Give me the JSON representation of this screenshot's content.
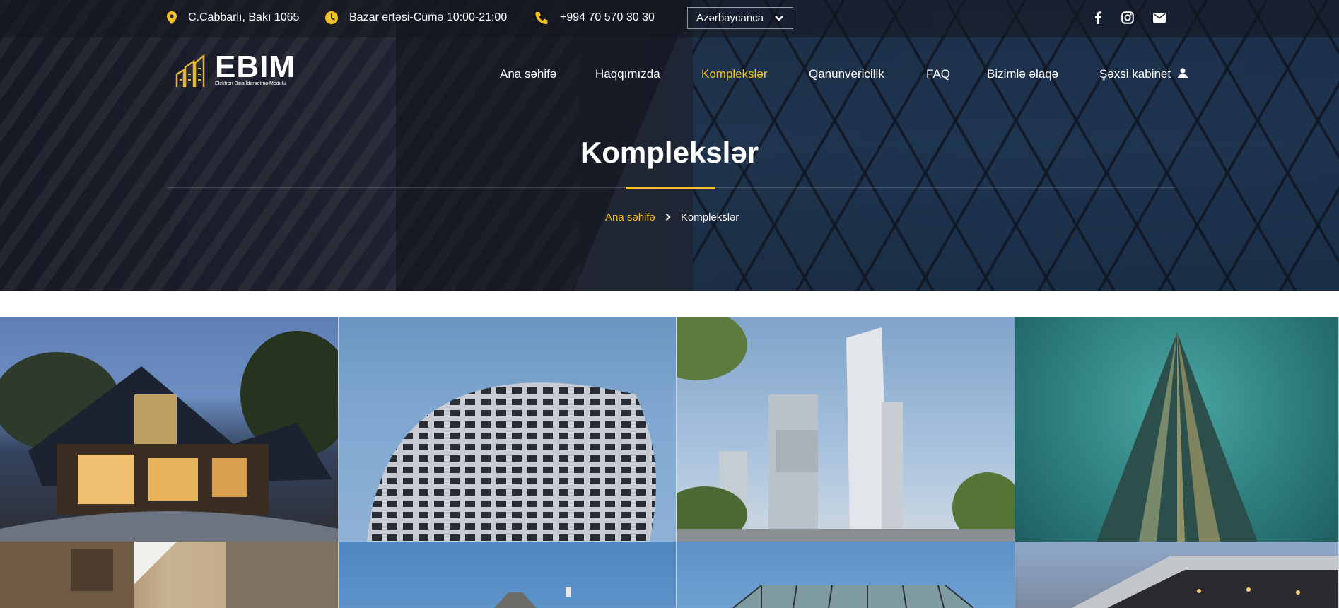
{
  "topbar": {
    "address": "C.Cabbarlı, Bakı 1065",
    "hours": "Bazar ertəsi-Cümə 10:00-21:00",
    "phone": "+994 70 570 30 30",
    "language": "Azərbaycanca",
    "social": [
      "facebook-icon",
      "instagram-icon",
      "mail-icon"
    ]
  },
  "logo": {
    "name": "EBIM",
    "tagline": "Elektron Bina İdarəetmə Modulu"
  },
  "nav": {
    "items": [
      {
        "label": "Ana səhifə"
      },
      {
        "label": "Haqqımızda"
      },
      {
        "label": "Komplekslər"
      },
      {
        "label": "Qanunvericilik"
      },
      {
        "label": "FAQ"
      },
      {
        "label": "Bizimlə əlaqə"
      },
      {
        "label": "Şəxsi kabinet"
      }
    ],
    "active": "Komplekslər"
  },
  "hero": {
    "title": "Komplekslər",
    "breadcrumb_home": "Ana səhifə",
    "breadcrumb_current": "Komplekslər"
  },
  "colors": {
    "accent": "#f3c321",
    "text_light": "#ffffff"
  },
  "gallery": {
    "tiles": [
      "house-photo",
      "curved-facade-photo",
      "twin-towers-photo",
      "triangle-tower-photo",
      "stone-wall-photo",
      "building-sky-photo",
      "glass-roof-photo",
      "canopy-photo"
    ]
  }
}
